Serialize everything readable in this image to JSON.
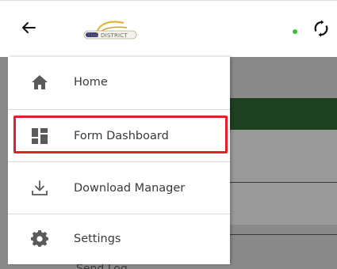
{
  "appbar": {
    "logo_text": "THE DISTRICT",
    "status_color": "#36c03a"
  },
  "menu": {
    "items": [
      {
        "label": "Home",
        "icon": "home-icon"
      },
      {
        "label": "Form Dashboard",
        "icon": "dashboard-icon"
      },
      {
        "label": "Download Manager",
        "icon": "download-icon"
      },
      {
        "label": "Settings",
        "icon": "gear-icon"
      }
    ]
  },
  "background": {
    "partial_item_label": "Send Log"
  },
  "colors": {
    "highlight": "#e3202a",
    "drawer_bg": "#ffffff",
    "icon": "#5a5a5a"
  }
}
